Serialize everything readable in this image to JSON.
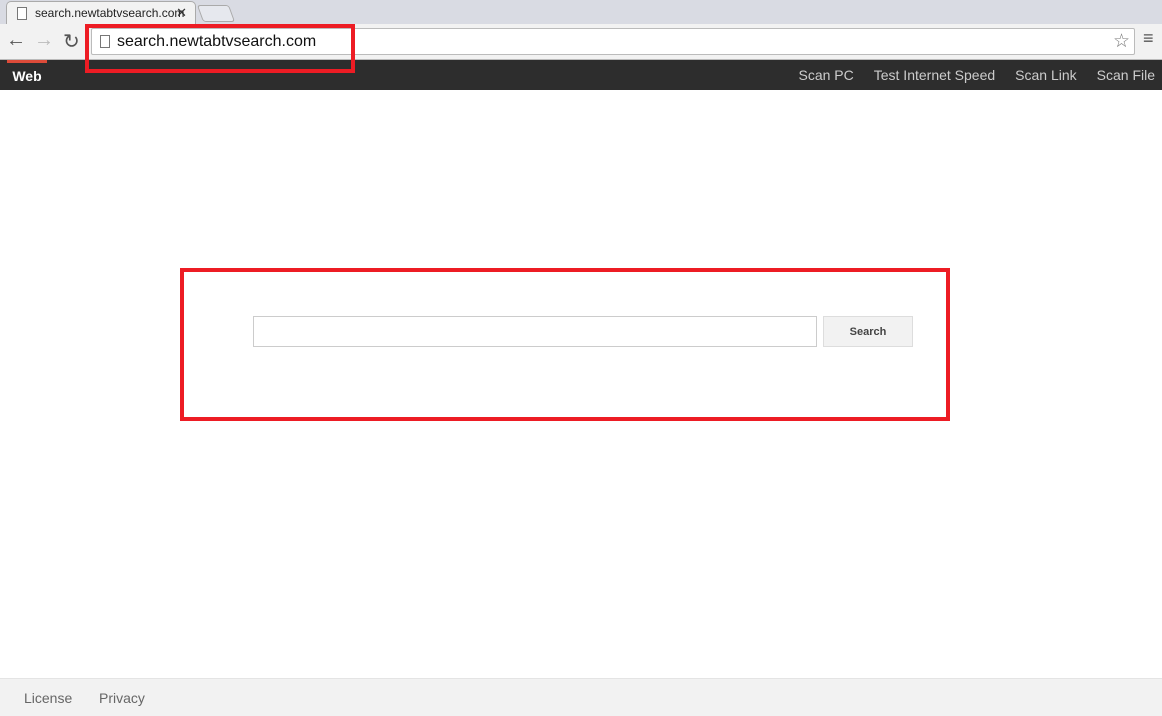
{
  "browser": {
    "tab_title": "search.newtabtvsearch.com",
    "url": "search.newtabtvsearch.com"
  },
  "navbar": {
    "active": "Web",
    "links": [
      "Scan PC",
      "Test Internet Speed",
      "Scan Link",
      "Scan File"
    ]
  },
  "search": {
    "value": "",
    "button": "Search"
  },
  "footer": {
    "license": "License",
    "privacy": "Privacy"
  },
  "colors": {
    "highlight": "#ed1c24",
    "navbar": "#2d2d2d",
    "accent": "#dd4b39"
  }
}
